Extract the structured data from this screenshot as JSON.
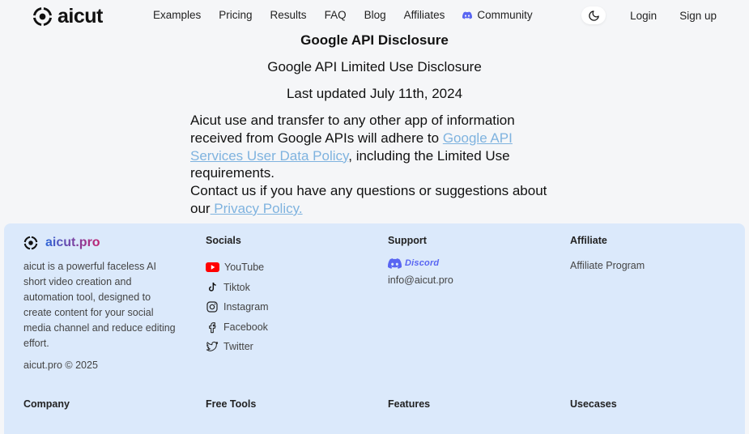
{
  "header": {
    "logo_text": "aicut",
    "nav": [
      "Examples",
      "Pricing",
      "Results",
      "FAQ",
      "Blog",
      "Affiliates"
    ],
    "community_label": "Community",
    "login_label": "Login",
    "signup_label": "Sign up"
  },
  "main": {
    "title": "Google API Disclosure",
    "subtitle": "Google API Limited Use Disclosure",
    "updated": "Last updated July 11th, 2024",
    "para1_pre": "Aicut use and transfer to any other app of information received from Google APIs will adhere to ",
    "para1_link": "Google API Services User Data Policy",
    "para1_post": ", including the Limited Use requirements.",
    "para2_pre": "Contact us if you have any questions or suggestions about our",
    "para2_link": " Privacy Policy."
  },
  "footer": {
    "brand_name": "aicut.pro",
    "brand_desc": "aicut is a powerful faceless AI short video creation and automation tool, designed to create content for your social media channel and reduce editing effort.",
    "copyright": "aicut.pro © 2025",
    "socials_heading": "Socials",
    "socials": [
      {
        "label": "YouTube",
        "icon": "youtube-icon"
      },
      {
        "label": "Tiktok",
        "icon": "tiktok-icon"
      },
      {
        "label": "Instagram",
        "icon": "instagram-icon"
      },
      {
        "label": "Facebook",
        "icon": "facebook-icon"
      },
      {
        "label": "Twitter",
        "icon": "twitter-icon"
      }
    ],
    "support_heading": "Support",
    "discord_label": "Discord",
    "support_email": "info@aicut.pro",
    "affiliate_heading": "Affiliate",
    "affiliate_link": "Affiliate Program",
    "row2": [
      "Company",
      "Free Tools",
      "Features",
      "Usecases"
    ]
  },
  "colors": {
    "footer_bg": "#dbe9fb",
    "link": "#7fb3df",
    "discord": "#5865f2",
    "youtube": "#ff0000"
  }
}
